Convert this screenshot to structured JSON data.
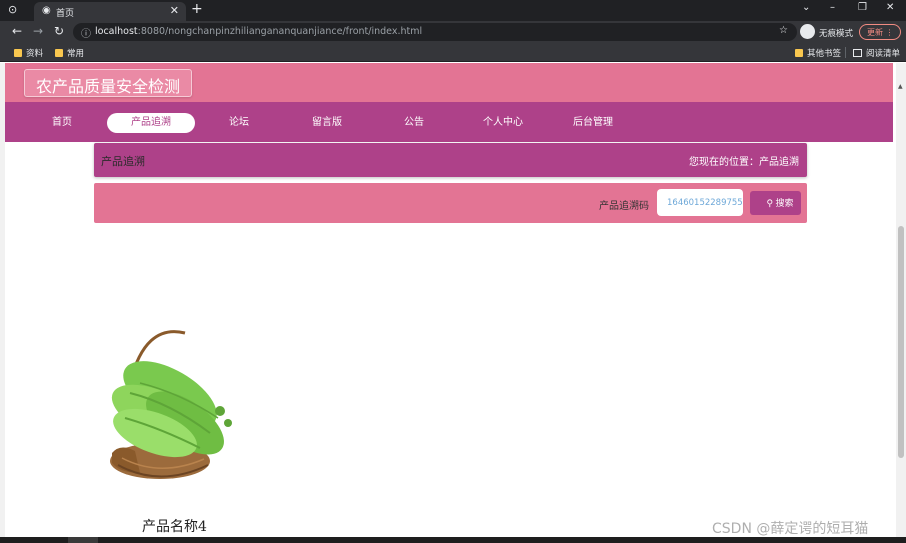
{
  "browser": {
    "tab_title": "首页",
    "url_host": "localhost",
    "url_rest": ":8080/nongchanpinzhiliangananquanjiance/front/index.html",
    "incognito_label": "无痕模式",
    "update_label": "更新",
    "bookmarks": [
      "资料",
      "常用"
    ],
    "other_bookmarks": "其他书签",
    "reading_list": "阅读清单"
  },
  "site": {
    "title": "农产品质量安全检测",
    "nav": [
      {
        "label": "首页",
        "active": false
      },
      {
        "label": "产品追溯",
        "active": true
      },
      {
        "label": "论坛",
        "active": false
      },
      {
        "label": "留言版",
        "active": false
      },
      {
        "label": "公告",
        "active": false
      },
      {
        "label": "个人中心",
        "active": false
      },
      {
        "label": "后台管理",
        "active": false
      }
    ]
  },
  "breadcrumb": {
    "title": "产品追溯",
    "location": "您现在的位置：产品追溯"
  },
  "search": {
    "label": "产品追溯码",
    "value": "16460152289755",
    "button_label": "搜索"
  },
  "products": [
    {
      "name": "产品名称4",
      "image": "bitter-melon-basket"
    }
  ],
  "watermark": "CSDN @薛定谔的短耳猫",
  "colors": {
    "header_pink": "#e37494",
    "nav_purple": "#ae4189",
    "chrome_dark": "#202124",
    "chrome_mid": "#35363a"
  }
}
